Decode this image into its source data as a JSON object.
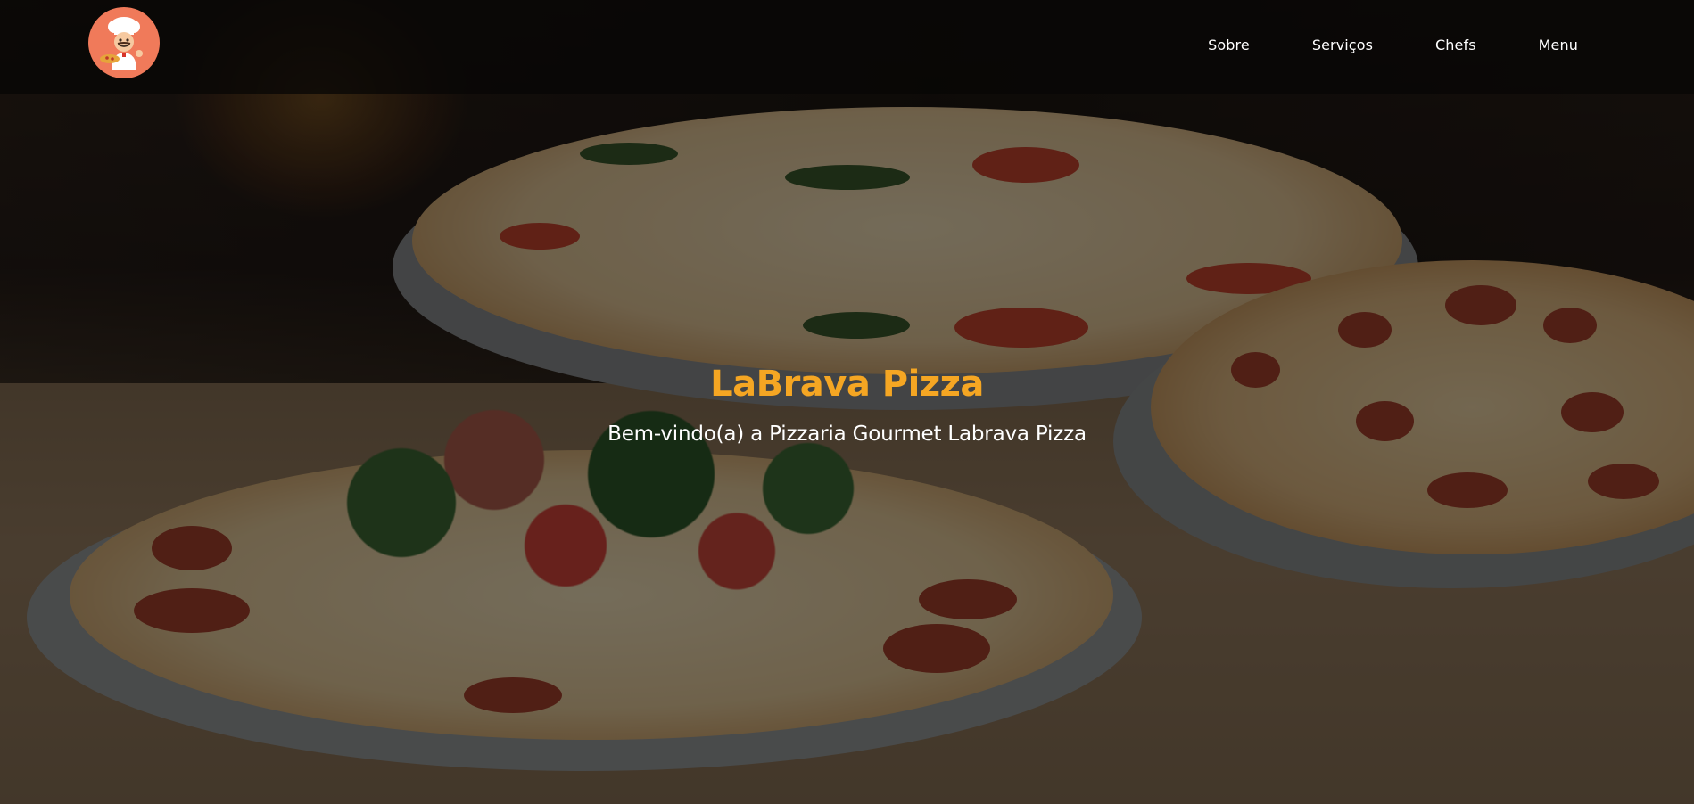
{
  "brand": {
    "logo_icon": "chef-mascot-logo",
    "logo_bg_color": "#f07a5a"
  },
  "navbar": {
    "items": [
      {
        "label": "Sobre"
      },
      {
        "label": "Serviços"
      },
      {
        "label": "Chefs"
      },
      {
        "label": "Menu"
      }
    ],
    "text_color": "#ffffff"
  },
  "hero": {
    "title": "LaBrava Pizza",
    "subtitle": "Bem-vindo(a) a Pizzaria Gourmet Labrava Pizza",
    "title_color": "#f5a623",
    "background": "pizza-photo"
  }
}
